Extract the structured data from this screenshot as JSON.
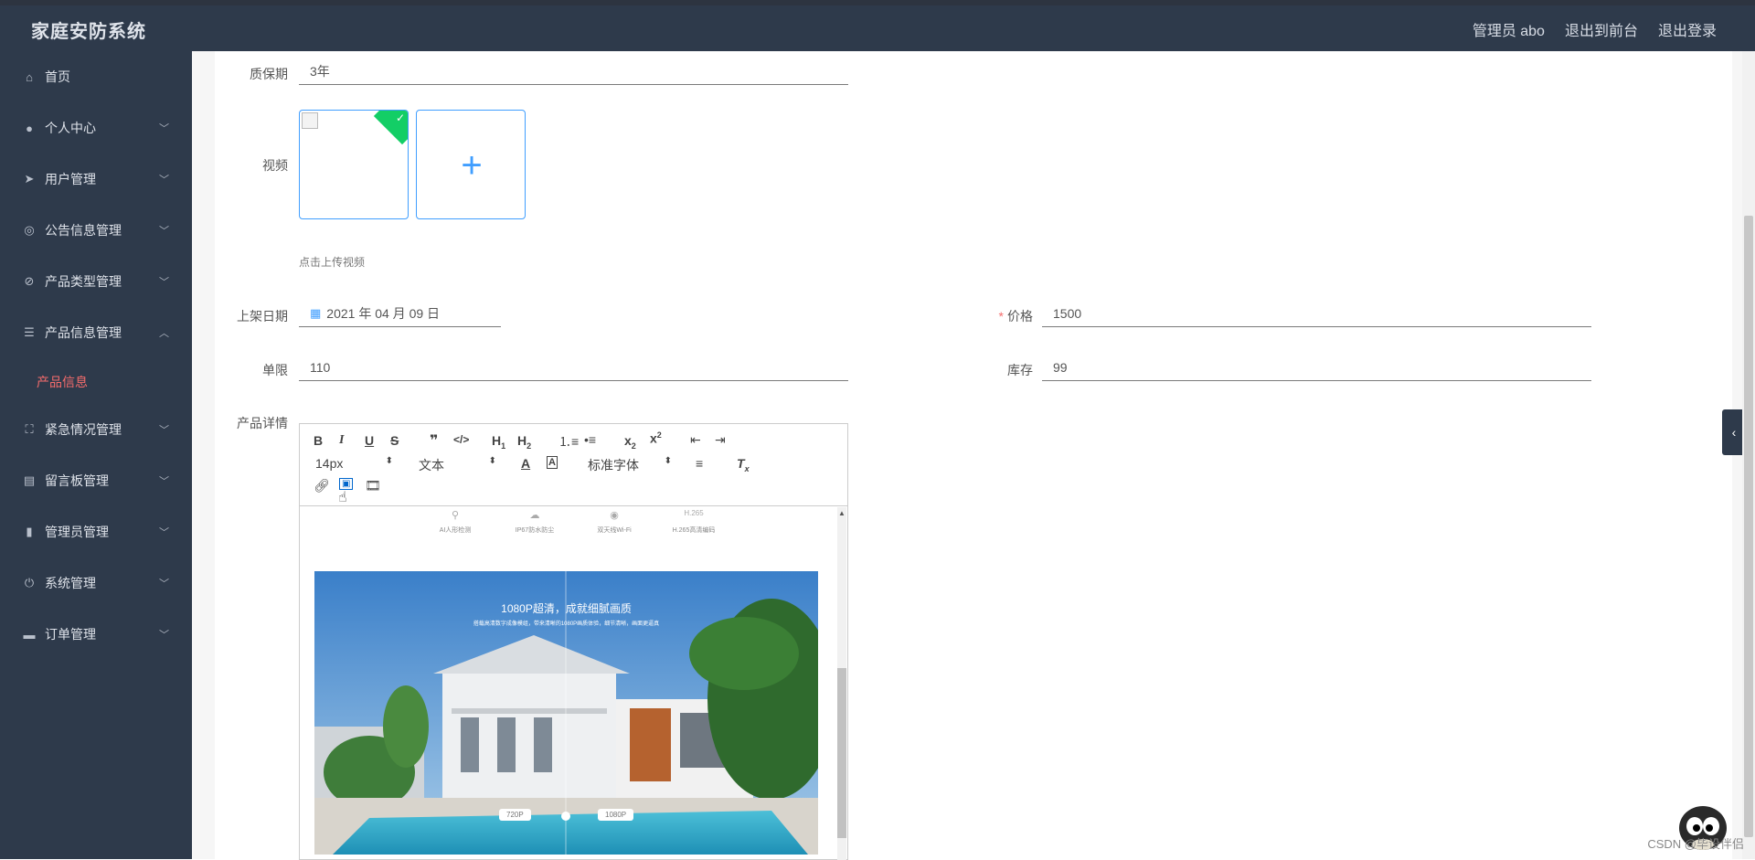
{
  "header": {
    "brand": "家庭安防系统",
    "admin_label": "管理员 abo",
    "to_front_label": "退出到前台",
    "logout_label": "退出登录"
  },
  "sidebar": {
    "items": [
      {
        "label": "首页",
        "icon": "home-icon"
      },
      {
        "label": "个人中心",
        "icon": "user-icon"
      },
      {
        "label": "用户管理",
        "icon": "paper-plane-icon"
      },
      {
        "label": "公告信息管理",
        "icon": "lifebuoy-icon"
      },
      {
        "label": "产品类型管理",
        "icon": "bell-off-icon"
      },
      {
        "label": "产品信息管理",
        "icon": "list-icon"
      },
      {
        "label": "紧急情况管理",
        "icon": "frame-icon"
      },
      {
        "label": "留言板管理",
        "icon": "printer-icon"
      },
      {
        "label": "管理员管理",
        "icon": "bar-chart-icon"
      },
      {
        "label": "系统管理",
        "icon": "power-icon"
      },
      {
        "label": "订单管理",
        "icon": "stamp-icon"
      }
    ],
    "active_sub": "产品信息"
  },
  "form": {
    "warranty": {
      "label": "质保期",
      "value": "3年"
    },
    "video": {
      "label": "视频",
      "tip": "点击上传视频"
    },
    "date": {
      "label": "上架日期",
      "value": "2021 年 04 月 09 日"
    },
    "price": {
      "label": "价格",
      "value": "1500"
    },
    "limit": {
      "label": "单限",
      "value": "110"
    },
    "stock": {
      "label": "库存",
      "value": "99"
    },
    "detail": {
      "label": "产品详情"
    }
  },
  "editor": {
    "font_size": "14px",
    "header_select": "文本",
    "font_family": "标准字体",
    "features": [
      {
        "icon": "person-icon",
        "label": "AI人形检测"
      },
      {
        "icon": "cloud-icon",
        "label": "IP67防水防尘"
      },
      {
        "icon": "wifi-icon",
        "label": "双天线Wi-Fi"
      },
      {
        "icon": "",
        "label": "H.265高清编码"
      }
    ],
    "feature_h265": "H.265",
    "photo_title": "1080P超清，成就细腻画质",
    "photo_subtitle": "搭载高清数字成像模组，带来清晰的1080P画质体验，细节清晰，画面更逼真",
    "pill_left": "720P",
    "pill_right": "1080P"
  },
  "watermark": "CSDN @毕设伴侣"
}
